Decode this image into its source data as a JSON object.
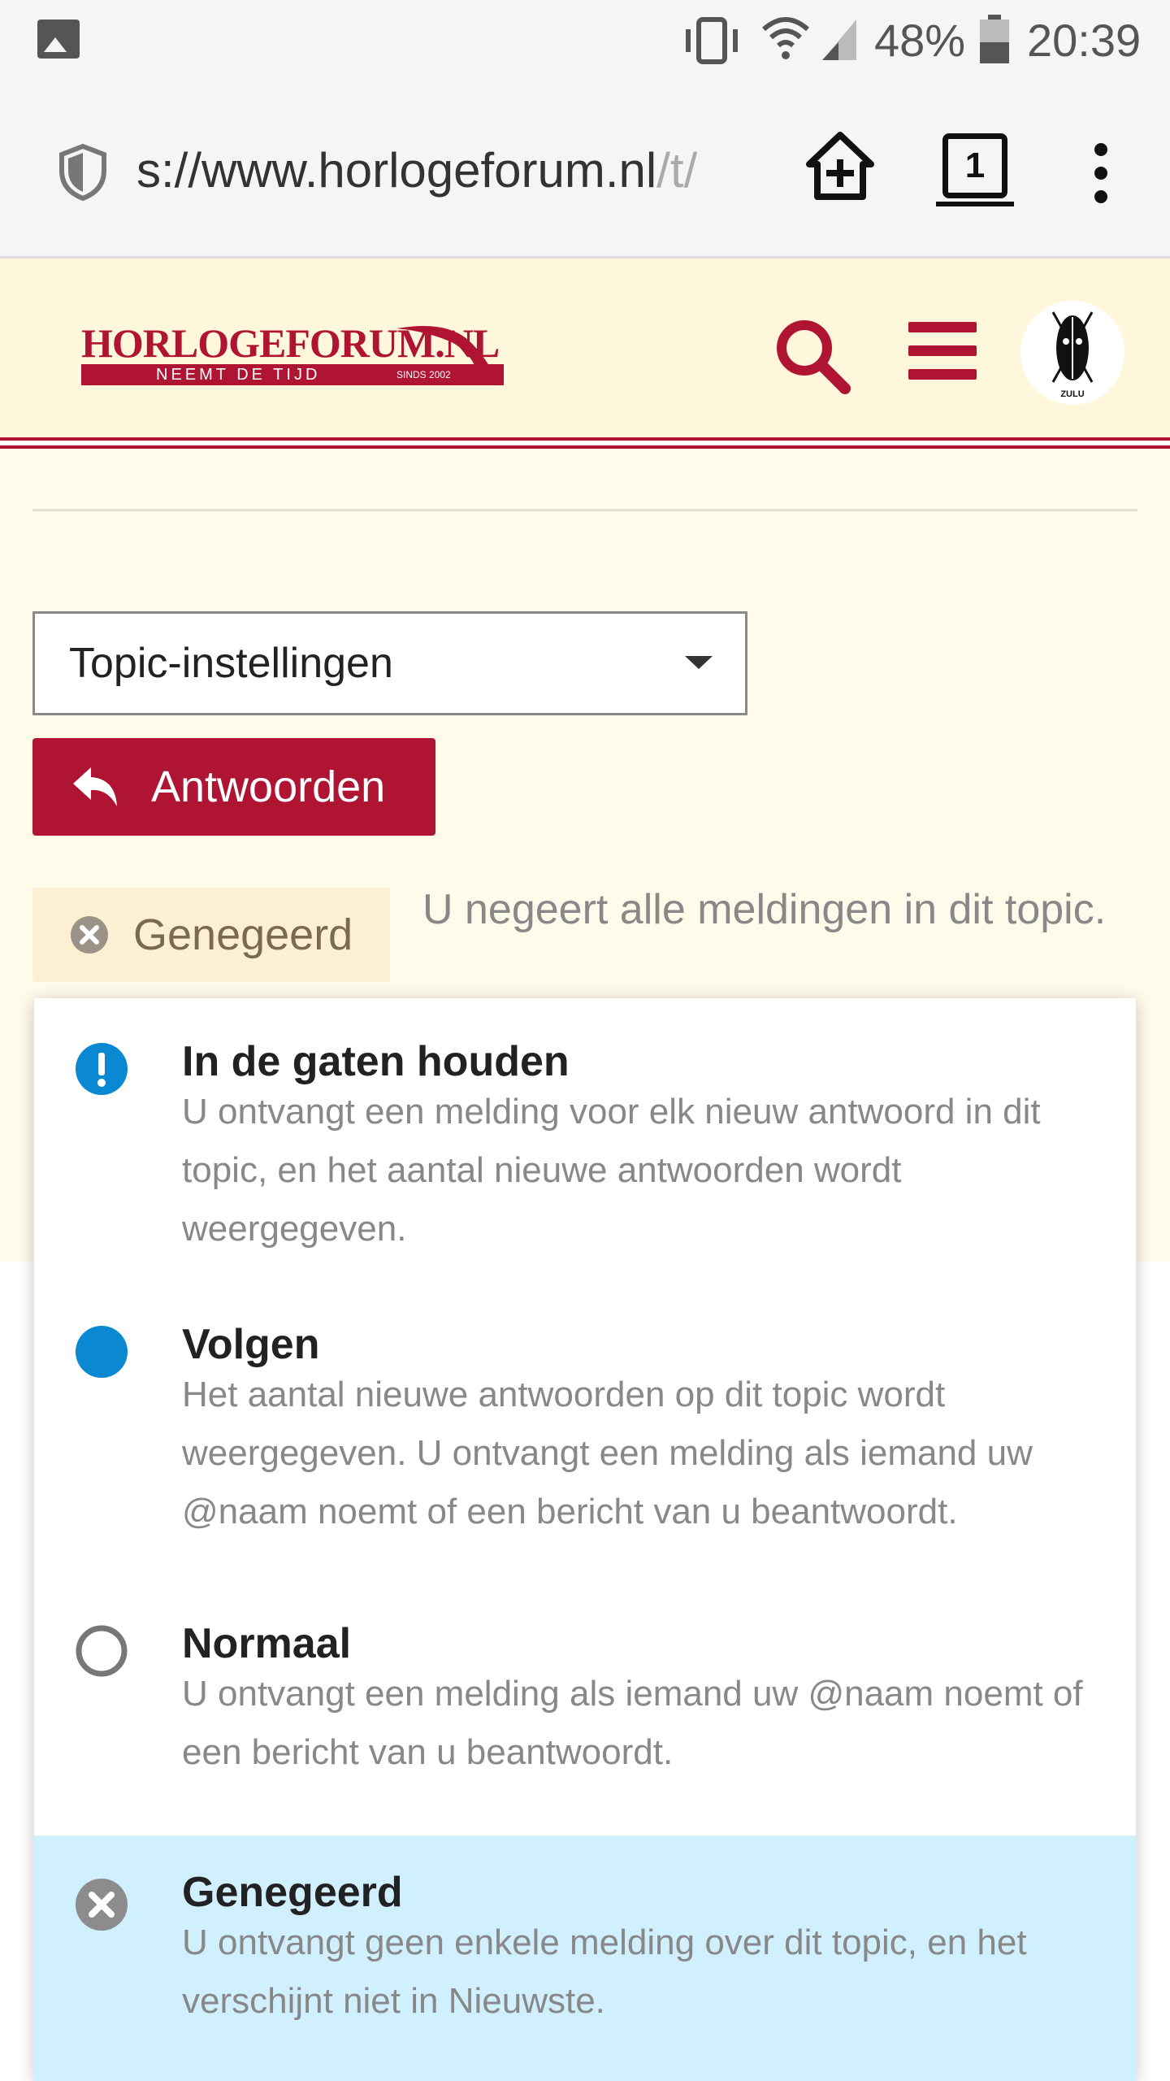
{
  "status_bar": {
    "battery_percent": "48%",
    "time": "20:39",
    "icons": [
      "image-icon",
      "vibrate-icon",
      "wifi-icon",
      "signal-icon",
      "battery-icon"
    ]
  },
  "browser": {
    "url_prefix": "s://www.horlogeforum.nl",
    "url_suffix": "/t/",
    "tab_count": "1",
    "icons": [
      "shield-icon",
      "home-add-icon",
      "tabs-icon",
      "more-vertical-icon"
    ]
  },
  "header": {
    "logo_title": "HORLOGEFORUM.NL",
    "logo_tagline": "NEEMT DE TIJD",
    "logo_since": "SINDS 2002",
    "avatar_caption": "ZULU",
    "icons": [
      "search-icon",
      "menu-icon",
      "avatar"
    ],
    "brand_color": "#b01433"
  },
  "topic": {
    "settings_select": "Topic-instellingen",
    "reply_button": "Antwoorden",
    "notification_level": "Genegeerd",
    "notification_description": "U negeert alle meldingen in dit topic."
  },
  "dropdown": {
    "options": [
      {
        "title": "In de gaten houden",
        "description": "U ontvangt een melding voor elk nieuw antwoord in dit topic, en het aantal nieuwe antwoorden wordt weergegeven.",
        "icon": "exclamation-circle-icon",
        "selected": false
      },
      {
        "title": "Volgen",
        "description": "Het aantal nieuwe antwoorden op dit topic wordt weergegeven. U ontvangt een melding als iemand uw @naam noemt of een bericht van u beantwoordt.",
        "icon": "filled-circle-icon",
        "selected": false
      },
      {
        "title": "Normaal",
        "description": "U ontvangt een melding als iemand uw @naam noemt of een bericht van u beantwoordt.",
        "icon": "empty-circle-icon",
        "selected": false
      },
      {
        "title": "Genegeerd",
        "description": "U ontvangt geen enkele melding over dit topic, en het verschijnt niet in Nieuwste.",
        "icon": "x-circle-icon",
        "selected": true
      }
    ],
    "accent_color": "#0a88d2",
    "selected_bg": "#d1f0ff"
  }
}
